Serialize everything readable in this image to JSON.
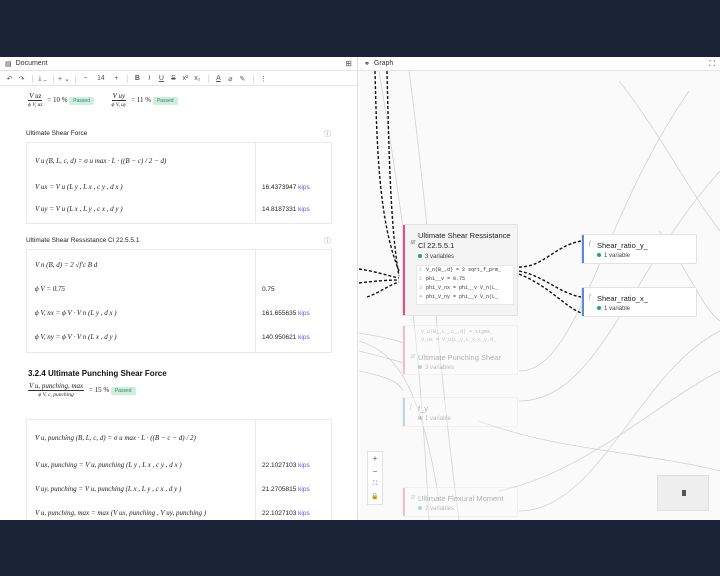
{
  "doc": {
    "title": "Document",
    "toolbar": {
      "undo": "↶",
      "redo": "↷",
      "insert": "⤓ ⌄",
      "plus": "+ ⌄",
      "minus": "−",
      "size": "14",
      "inc": "+",
      "bold": "B",
      "italic": "I",
      "underline": "U",
      "strike": "S",
      "sup": "x²",
      "sub": "x₂",
      "color": "A",
      "more": "⋮"
    },
    "ratio_top": {
      "a_num": "V uz",
      "a_den": "ϕ V, uz",
      "a_val": "= 10 %",
      "a_badge": "Passed",
      "b_num": "V uy",
      "b_den": "ϕ V, uy",
      "b_val": "= 11 %",
      "b_badge": "Passed"
    },
    "sec1": {
      "title": "Ultimate Shear Force",
      "rows": [
        {
          "lhs": "V u (B, L, c, d) = σ u max · L · ((B − c) / 2 − d)",
          "val": "",
          "unit": ""
        },
        {
          "lhs": "V ux = V u (L y , L x , c y , d x )",
          "val": "16.4373947",
          "unit": "kips"
        },
        {
          "lhs": "V uy = V u (L x , L y , c x , d y )",
          "val": "14.8187331",
          "unit": "kips"
        }
      ]
    },
    "sec2": {
      "title": "Ultimate Shear Ressistance Cl 22.5.5.1",
      "rows": [
        {
          "lhs": "V n (B, d) = 2 √f'c B d",
          "val": "",
          "unit": ""
        },
        {
          "lhs": "ϕ V = 0.75",
          "val": "0.75",
          "unit": ""
        },
        {
          "lhs": "ϕ V, nx = ϕ V · V n (L y , d x )",
          "val": "161.655635",
          "unit": "kips"
        },
        {
          "lhs": "ϕ V, ny = ϕ V · V n (L x , d y )",
          "val": "140.950621",
          "unit": "kips"
        }
      ]
    },
    "sec3": {
      "heading": "3.2.4 Ultimate Punching Shear Force",
      "ratio_num": "V u, punching, max",
      "ratio_den": "ϕ V, c, punching",
      "ratio_val": "= 15 %",
      "ratio_badge": "Passed",
      "rows": [
        {
          "lhs": "V u, punching (B, L, c, d) = σ u max · L · ((B − c − d) / 2)",
          "val": "",
          "unit": ""
        },
        {
          "lhs": "V ux, punching = V u, punching (L y , L x , c y , d x )",
          "val": "22.1027103",
          "unit": "kips"
        },
        {
          "lhs": "V uy, punching = V u, punching (L x , L y , c x , d y )",
          "val": "21.2705815",
          "unit": "kips"
        },
        {
          "lhs": "V u, punching, max = max (V ux, punching , V uy, punching )",
          "val": "22.1027103",
          "unit": "kips"
        }
      ]
    }
  },
  "graph": {
    "title": "Graph",
    "nodes": {
      "main_title": "Ultimate Shear Ressistance Cl 22.5.5.1",
      "main_vars": "3 variables",
      "code": [
        {
          "no": "1",
          "text": "V_n(B_,d) = 2 sqrt_f_prm_"
        },
        {
          "no": "2",
          "text": "phi__v = 0.75"
        },
        {
          "no": "3",
          "text": "phi_V_nx = phi__v V_n(L_"
        },
        {
          "no": "4",
          "text": "phi_V_ny = phi__v V_n(L_"
        }
      ],
      "faded_code_1": "V_u(B_,L_,c_,d) = sigma_",
      "faded_code_2": "V_ux = V_u(L_y,L_x,c_y,d_",
      "punching_title": "Ultimate Punching Shear",
      "punching_vars": "3 variables",
      "fy_title": "f_y",
      "fy_vars": "1 variable",
      "flex_title": "Ultimate Flexural Moment",
      "flex_vars": "2 variables",
      "sy_title": "Shear_ratio_y_",
      "sy_vars": "1 variable",
      "sx_title": "Shear_ratio_x_",
      "sx_vars": "1 variable"
    },
    "zoom": {
      "plus": "+",
      "minus": "−",
      "fit": "⛶",
      "lock": "🔒"
    }
  }
}
